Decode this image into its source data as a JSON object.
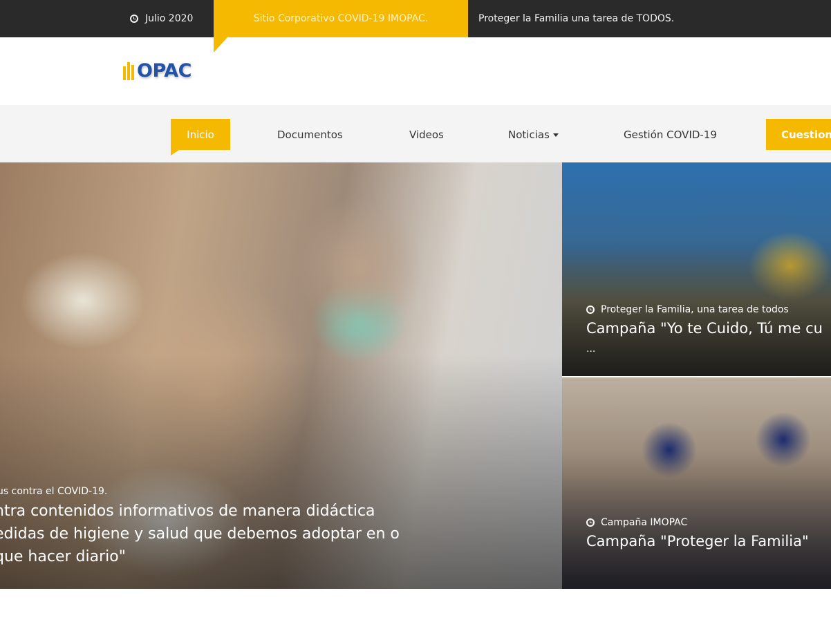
{
  "topbar": {
    "date": "Julio 2020",
    "tag": "Sitio Corporativo COVID-19 IMOPAC.",
    "tagline": "Proteger la Familia una tarea de TODOS.",
    "clock_icon": "clock-icon",
    "accent_color": "#f4b900",
    "background": "#2a2a2a"
  },
  "logo": {
    "text": "OPAC"
  },
  "nav": {
    "items": [
      {
        "label": "Inicio",
        "active": true
      },
      {
        "label": "Documentos"
      },
      {
        "label": "Videos"
      },
      {
        "label": "Noticias",
        "has_dropdown": true
      },
      {
        "label": "Gestión COVID-19"
      },
      {
        "label": "Cuestione",
        "active": true
      }
    ]
  },
  "hero": {
    "category": "us contra el COVID-19.",
    "title": "ntra contenidos informativos de manera didáctica edidas de higiene y salud que debemos adoptar en o que hacer diario\""
  },
  "cards": [
    {
      "category": "Proteger la Familia, una tarea de todos",
      "title": "Campaña \"Yo te Cuido, Tú me cu",
      "ellipsis": "..."
    },
    {
      "category": "Campaña IMOPAC",
      "title": "Campaña \"Proteger la Familia\""
    }
  ]
}
